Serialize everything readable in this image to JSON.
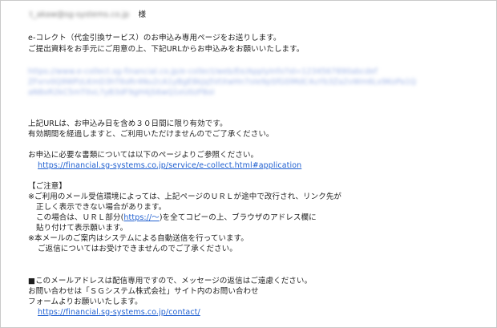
{
  "recipient": {
    "address_redacted": "t_akaw@sg-systems.co.jp",
    "honorific": "様"
  },
  "intro": {
    "line1": "e-コレクト（代金引換サービス）のお申込み専用ページをお送りします。",
    "line2": "ご提出資料をお手元にご用意の上、下記URLからお申込みをお願いいたします。"
  },
  "redacted_url": {
    "line1": "https://www.e-collect.sg-financial.co.jp/e-collect/web/Ee/ApplyInfo?id=1234567890abcdef",
    "line2": "ZFxrv0Q9WPzLKmD3hT6sRr4Nu2cA1yBgE8kJq5VtXwHn7oIe9pSfG0lMdC4uYb3Za2vWm6Lx9KoPa1Q",
    "line3": "aN8xR2kC5mT0vL7yB3dF9gH4jS6wQ1eU0zP8oI"
  },
  "validity": {
    "line1": "上記URLは、お申込み日を含め３０日間に限り有効です。",
    "line2": "有効期間を経過しますと、ご利用いただけませんのでご了承ください。"
  },
  "documents": {
    "line1": "お申込に必要な書類については以下のページよりご参照ください。",
    "link": "https://financial.sg-systems.co.jp/service/e-collect.html#application"
  },
  "notice": {
    "title": "【ご注意】",
    "line1": "※ご利用のメール受信環境によっては、上記ページのＵＲＬが途中で改行され、リンク先が",
    "line2": "正しく表示できない場合があります。",
    "line3_pre": "この場合は、ＵＲＬ部分(",
    "line3_link": "https://～",
    "line3_post": ")を全てコピーの上、ブラウザのアドレス欄に",
    "line4": "貼り付けて表示願います。",
    "line5": "※本メールのご案内はシステムによる自動送信を行っています。",
    "line6": "ご返信についてはお受けできませんのでご了承ください。"
  },
  "footer": {
    "line1": "■このメールアドレスは配信専用ですので、メッセージの返信はご遠慮ください。",
    "line2": "お問い合わせは「ＳＧシステム株式会社」サイト内のお問い合わせ",
    "line3": "フォームよりお願いいたします。",
    "link": "https://financial.sg-systems.co.jp/contact/"
  }
}
